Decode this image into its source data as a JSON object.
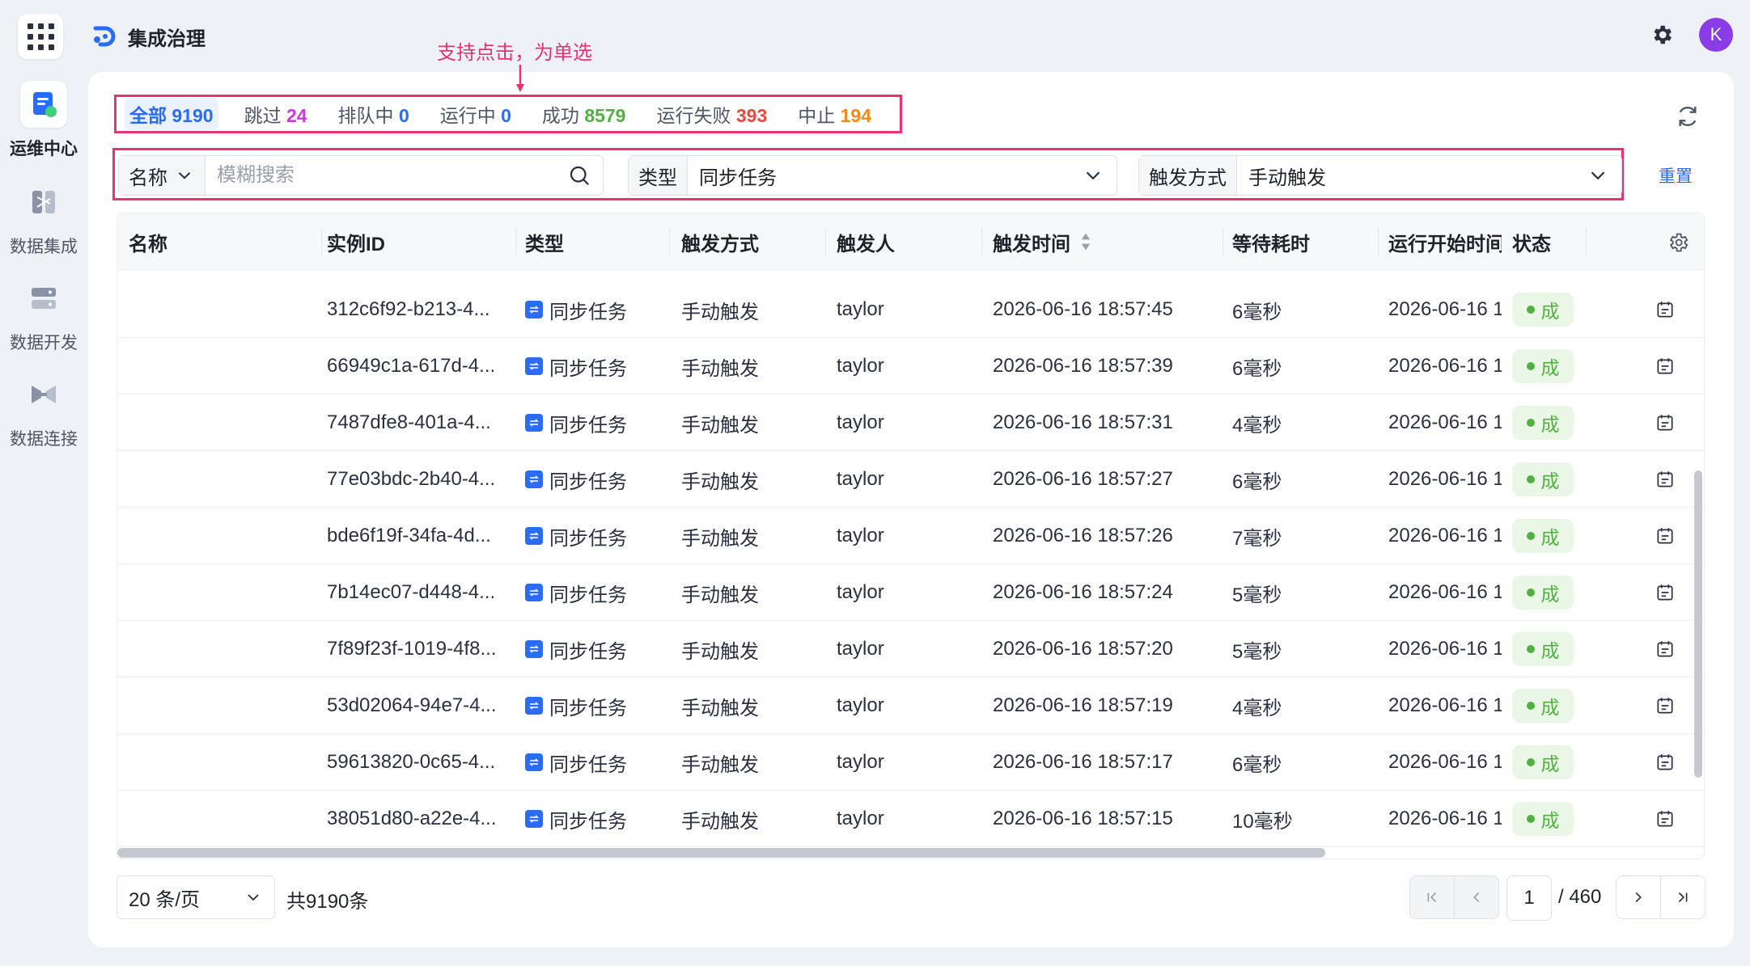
{
  "app": {
    "title": "集成治理",
    "avatar_initial": "K"
  },
  "sidebar": {
    "items": [
      {
        "label": "运维中心",
        "icon": "ops-center-icon",
        "active": true
      },
      {
        "label": "数据集成",
        "icon": "data-integration-icon",
        "active": false
      },
      {
        "label": "数据开发",
        "icon": "data-dev-icon",
        "active": false
      },
      {
        "label": "数据连接",
        "icon": "data-connect-icon",
        "active": false
      }
    ]
  },
  "annotation": {
    "text": "支持点击，为单选"
  },
  "status_tabs": [
    {
      "label": "全部",
      "count": "9190",
      "color": "#2a6cf6",
      "active": true
    },
    {
      "label": "跳过",
      "count": "24",
      "color": "#c93bd6",
      "active": false
    },
    {
      "label": "排队中",
      "count": "0",
      "color": "#2a6cf6",
      "active": false
    },
    {
      "label": "运行中",
      "count": "0",
      "color": "#2a6cf6",
      "active": false
    },
    {
      "label": "成功",
      "count": "8579",
      "color": "#52b043",
      "active": false
    },
    {
      "label": "运行失败",
      "count": "393",
      "color": "#e8483e",
      "active": false
    },
    {
      "label": "中止",
      "count": "194",
      "color": "#f08a1c",
      "active": false
    }
  ],
  "filters": {
    "name_field": {
      "label": "名称",
      "placeholder": "模糊搜索"
    },
    "type_field": {
      "label": "类型",
      "value": "同步任务"
    },
    "trigger_field": {
      "label": "触发方式",
      "value": "手动触发"
    },
    "reset_label": "重置"
  },
  "table": {
    "columns": [
      "名称",
      "实例ID",
      "类型",
      "触发方式",
      "触发人",
      "触发时间",
      "等待耗时",
      "运行开始时间",
      "状态"
    ],
    "rows": [
      {
        "name": "",
        "id": "312c6f92-b213-4...",
        "type": "同步任务",
        "trigger": "手动触发",
        "user": "taylor",
        "time": "2026-06-16 18:57:45",
        "wait": "6毫秒",
        "start": "2026-06-16 1",
        "status": "成"
      },
      {
        "name": "",
        "id": "66949c1a-617d-4...",
        "type": "同步任务",
        "trigger": "手动触发",
        "user": "taylor",
        "time": "2026-06-16 18:57:39",
        "wait": "6毫秒",
        "start": "2026-06-16 1",
        "status": "成"
      },
      {
        "name": "",
        "id": "7487dfe8-401a-4...",
        "type": "同步任务",
        "trigger": "手动触发",
        "user": "taylor",
        "time": "2026-06-16 18:57:31",
        "wait": "4毫秒",
        "start": "2026-06-16 1",
        "status": "成"
      },
      {
        "name": "",
        "id": "77e03bdc-2b40-4...",
        "type": "同步任务",
        "trigger": "手动触发",
        "user": "taylor",
        "time": "2026-06-16 18:57:27",
        "wait": "6毫秒",
        "start": "2026-06-16 1",
        "status": "成"
      },
      {
        "name": "",
        "id": "bde6f19f-34fa-4d...",
        "type": "同步任务",
        "trigger": "手动触发",
        "user": "taylor",
        "time": "2026-06-16 18:57:26",
        "wait": "7毫秒",
        "start": "2026-06-16 1",
        "status": "成"
      },
      {
        "name": "",
        "id": "7b14ec07-d448-4...",
        "type": "同步任务",
        "trigger": "手动触发",
        "user": "taylor",
        "time": "2026-06-16 18:57:24",
        "wait": "5毫秒",
        "start": "2026-06-16 1",
        "status": "成"
      },
      {
        "name": "",
        "id": "7f89f23f-1019-4f8...",
        "type": "同步任务",
        "trigger": "手动触发",
        "user": "taylor",
        "time": "2026-06-16 18:57:20",
        "wait": "5毫秒",
        "start": "2026-06-16 1",
        "status": "成"
      },
      {
        "name": "",
        "id": "53d02064-94e7-4...",
        "type": "同步任务",
        "trigger": "手动触发",
        "user": "taylor",
        "time": "2026-06-16 18:57:19",
        "wait": "4毫秒",
        "start": "2026-06-16 1",
        "status": "成"
      },
      {
        "name": "",
        "id": "59613820-0c65-4...",
        "type": "同步任务",
        "trigger": "手动触发",
        "user": "taylor",
        "time": "2026-06-16 18:57:17",
        "wait": "6毫秒",
        "start": "2026-06-16 1",
        "status": "成"
      },
      {
        "name": "",
        "id": "38051d80-a22e-4...",
        "type": "同步任务",
        "trigger": "手动触发",
        "user": "taylor",
        "time": "2026-06-16 18:57:15",
        "wait": "10毫秒",
        "start": "2026-06-16 1",
        "status": "成"
      }
    ]
  },
  "pagination": {
    "page_size_label": "20 条/页",
    "total_label": "共9190条",
    "current_page": "1",
    "total_pages_label": "/ 460"
  },
  "colors": {
    "accent": "#2a6cf6",
    "annotation": "#e8336f",
    "success": "#52b043"
  }
}
